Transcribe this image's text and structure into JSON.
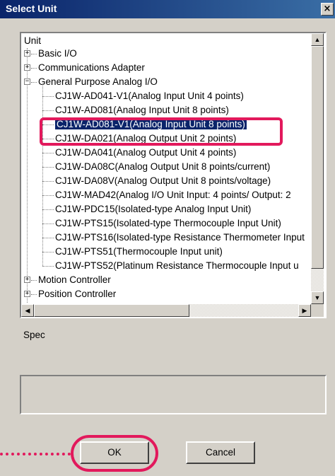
{
  "dialog": {
    "title": "Select Unit",
    "close_glyph": "×"
  },
  "tree": {
    "header": "Unit",
    "nodes": [
      {
        "label": "Basic I/O",
        "expander": "+"
      },
      {
        "label": "Communications Adapter",
        "expander": "+"
      },
      {
        "label": "General Purpose Analog I/O",
        "expander": "−"
      },
      {
        "label": "CJ1W-AD041-V1(Analog Input Unit 4 points)"
      },
      {
        "label": "CJ1W-AD081(Analog Input Unit 8 points)"
      },
      {
        "label": "CJ1W-AD081-V1(Analog Input Unit 8 points)",
        "selected": true
      },
      {
        "label": "CJ1W-DA021(Analog Output Unit 2 points)"
      },
      {
        "label": "CJ1W-DA041(Analog Output Unit 4 points)"
      },
      {
        "label": "CJ1W-DA08C(Analog Output Unit 8 points/current)"
      },
      {
        "label": "CJ1W-DA08V(Analog Output Unit 8 points/voltage)"
      },
      {
        "label": "CJ1W-MAD42(Analog I/O Unit Input: 4 points/ Output: 2"
      },
      {
        "label": "CJ1W-PDC15(Isolated-type Analog Input Unit)"
      },
      {
        "label": "CJ1W-PTS15(Isolated-type Thermocouple Input Unit)"
      },
      {
        "label": "CJ1W-PTS16(Isolated-type Resistance Thermometer Input"
      },
      {
        "label": "CJ1W-PTS51(Thermocouple Input unit)"
      },
      {
        "label": "CJ1W-PTS52(Platinum Resistance Thermocouple Input u"
      },
      {
        "label": "Motion Controller",
        "expander": "+"
      },
      {
        "label": "Position Controller",
        "expander": "+"
      }
    ]
  },
  "spec": {
    "label": "Spec",
    "value": ""
  },
  "buttons": {
    "ok": "OK",
    "cancel": "Cancel"
  },
  "colors": {
    "selection": "#0a246a",
    "annotation": "#e2195c",
    "title_bar": "#0a246a"
  },
  "icons": {
    "scroll_up": "▲",
    "scroll_down": "▼",
    "scroll_left": "◀",
    "scroll_right": "▶"
  }
}
